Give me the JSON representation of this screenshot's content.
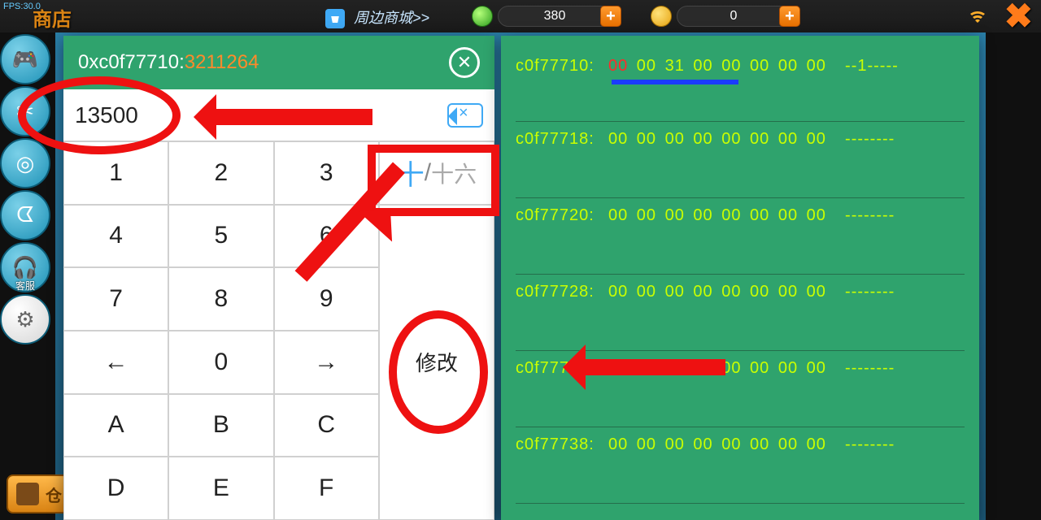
{
  "fps": "FPS:30.0",
  "shop_title": "商店",
  "mall_link": "周边商城>>",
  "currency1": "380",
  "currency2": "0",
  "sidebar": {
    "items": [
      {
        "icon": "🎮",
        "label": ""
      },
      {
        "icon": "✂",
        "label": ""
      },
      {
        "icon": "◎",
        "label": ""
      },
      {
        "icon": "ᗧ",
        "label": ""
      },
      {
        "icon": "🎧",
        "label": "客服"
      },
      {
        "icon": "⚙",
        "label": ""
      }
    ]
  },
  "bottom_button": "仓",
  "editor": {
    "address_hex": "0xc0f77710:",
    "address_dec": "3211264",
    "input_value": "13500",
    "keys": {
      "k1": "1",
      "k2": "2",
      "k3": "3",
      "k4": "4",
      "k5": "5",
      "k6": "6",
      "k7": "7",
      "k8": "8",
      "k9": "9",
      "kleft": "←",
      "k0": "0",
      "kright": "→",
      "kA": "A",
      "kB": "B",
      "kC": "C",
      "kD": "D",
      "kE": "E",
      "kF": "F",
      "hex_dec": "十",
      "hex_hex": "十六",
      "modify": "修改"
    }
  },
  "memory": {
    "rows": [
      {
        "addr": "c0f77710:",
        "bytes": [
          "00",
          "00",
          "31",
          "00",
          "00",
          "00",
          "00",
          "00"
        ],
        "first_red": true,
        "ascii": "--1-----"
      },
      {
        "addr": "c0f77718:",
        "bytes": [
          "00",
          "00",
          "00",
          "00",
          "00",
          "00",
          "00",
          "00"
        ],
        "first_red": false,
        "ascii": "--------"
      },
      {
        "addr": "c0f77720:",
        "bytes": [
          "00",
          "00",
          "00",
          "00",
          "00",
          "00",
          "00",
          "00"
        ],
        "first_red": false,
        "ascii": "--------"
      },
      {
        "addr": "c0f77728:",
        "bytes": [
          "00",
          "00",
          "00",
          "00",
          "00",
          "00",
          "00",
          "00"
        ],
        "first_red": false,
        "ascii": "--------"
      },
      {
        "addr": "c0f77730:",
        "bytes": [
          "00",
          "00",
          "00",
          "00",
          "00",
          "00",
          "00",
          "00"
        ],
        "first_red": false,
        "ascii": "--------"
      },
      {
        "addr": "c0f77738:",
        "bytes": [
          "00",
          "00",
          "00",
          "00",
          "00",
          "00",
          "00",
          "00"
        ],
        "first_red": false,
        "ascii": "--------"
      }
    ]
  }
}
